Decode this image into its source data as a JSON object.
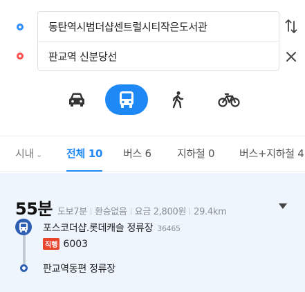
{
  "route": {
    "origin": "동탄역시범더샵센트럴시티작은도서관",
    "destination": "판교역 신분당선",
    "origin_pin_color": "#2b8cff",
    "destination_pin_color": "#ff4c4c",
    "swap_icon": "swap-vertical-icon",
    "clear_icon": "close-icon"
  },
  "modes": [
    {
      "icon": "car-icon",
      "active": false
    },
    {
      "icon": "bus-icon",
      "active": true
    },
    {
      "icon": "walk-icon",
      "active": false
    },
    {
      "icon": "bicycle-icon",
      "active": false
    }
  ],
  "accent_color": "#1e88f5",
  "tabs": {
    "area": "시내",
    "all": "전체 10",
    "bus": "버스 6",
    "subway": "지하철 0",
    "bus_subway": "버스+지하철 4"
  },
  "result": {
    "time": "55분",
    "walk": "도보7분",
    "transfer": "환승없음",
    "fare": "요금 2,800원",
    "distance": "29.4km",
    "board_stop": "포스코더샵.롯데캐슬 정류장",
    "board_stop_id": "36465",
    "route_type": "직행",
    "route_type_color": "#e8452c",
    "route_number": "6003",
    "alight_stop": "판교역동편 정류장"
  }
}
